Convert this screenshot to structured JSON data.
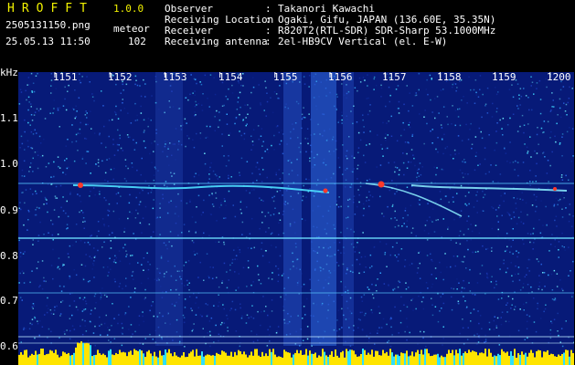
{
  "header": {
    "app_title": "HROFFT",
    "version": "1.0.0",
    "filename": "2505131150.png",
    "mode": "meteor",
    "timestamp": "25.05.13 11:50",
    "count": "102"
  },
  "station": [
    {
      "label": "Observer",
      "value": "Takanori Kawachi"
    },
    {
      "label": "Receiving Location",
      "value": "Ogaki, Gifu, JAPAN (136.60E, 35.35N)"
    },
    {
      "label": "Receiver",
      "value": "R820T2(RTL-SDR) SDR-Sharp 53.1000MHz"
    },
    {
      "label": "Receiving antenna",
      "value": "2el-HB9CV Vertical (el. E-W)"
    }
  ],
  "axes": {
    "y_unit": "kHz",
    "y_ticks": [
      "1.1",
      "1.0",
      "0.9",
      "0.8",
      "0.7",
      "0.6"
    ],
    "x_ticks": [
      "1151",
      "1152",
      "1153",
      "1154",
      "1155",
      "1156",
      "1157",
      "1158",
      "1159",
      "1200"
    ]
  },
  "colors": {
    "background": "#000000",
    "text_yellow": "#f2f200",
    "text_white": "#ffffff",
    "noise_blue": "#1e2fa8",
    "noise_cyan": "#2fe0ff",
    "trace_red": "#ff3a2a",
    "floor_yellow": "#ffe400"
  }
}
